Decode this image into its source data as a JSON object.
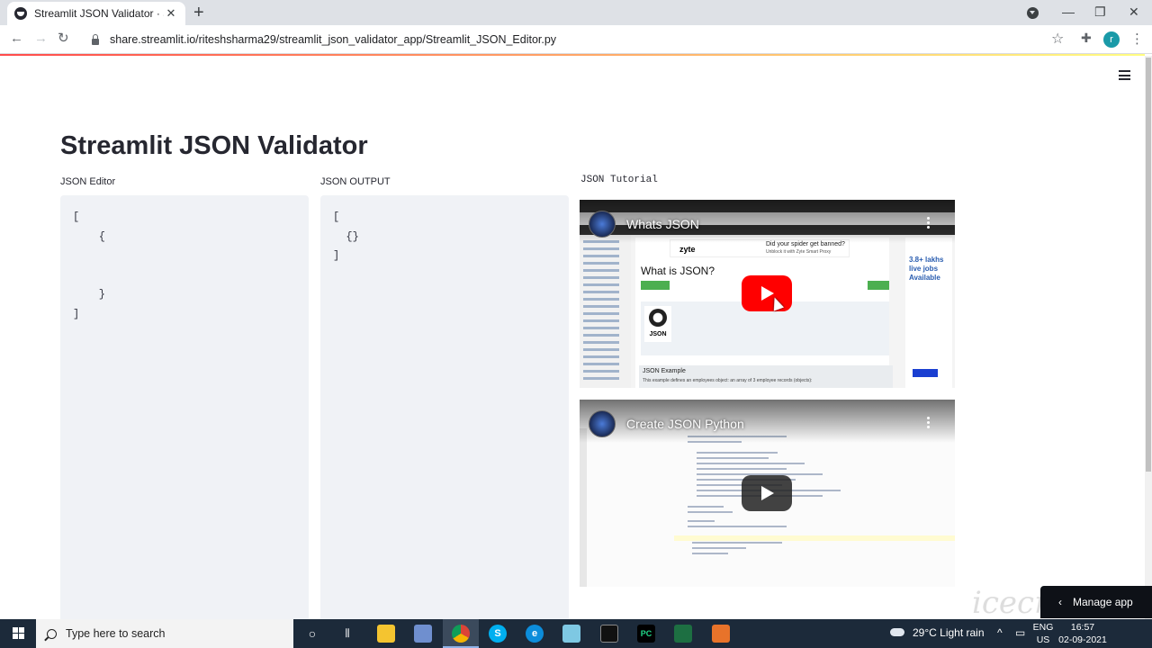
{
  "browser": {
    "tab_title": "Streamlit JSON Validator · Stream",
    "tab_close": "✕",
    "new_tab": "+",
    "url": "share.streamlit.io/riteshsharma29/streamlit_json_validator_app/Streamlit_JSON_Editor.py",
    "profile_initial": "r",
    "icons": [
      "back-icon",
      "forward-icon",
      "reload-icon",
      "lock-icon",
      "star-icon",
      "extensions-icon",
      "menu-icon"
    ]
  },
  "app": {
    "title": "Streamlit JSON Validator",
    "editor_label": "JSON Editor",
    "editor_value": "[\n    {\n\n\n    }\n]",
    "output_label": "JSON OUTPUT",
    "output_value": "[\n  {}\n]",
    "tutorial_label": "JSON Tutorial",
    "manage_app": "Manage app",
    "accent_color": "#ff4b4b"
  },
  "videos": [
    {
      "title": "Whats JSON",
      "inner": {
        "ad_text": "Did your spider get banned?",
        "ad_sub": "Unblock it with Zyte Smart Proxy",
        "brand": "zyte",
        "heading": "What is JSON?",
        "logo_text": "JSON",
        "side_promo": "3.8+ lakhs live jobs Available",
        "example_heading": "JSON Example",
        "example_text": "This example defines an employees object: an array of 3 employee records (objects):"
      }
    },
    {
      "title": "Create JSON Python"
    }
  ],
  "taskbar": {
    "search_placeholder": "Type here to search",
    "weather": "29°C  Light rain",
    "lang_top": "ENG",
    "lang_bottom": "US",
    "time": "16:57",
    "date": "02-09-2021",
    "apps": [
      {
        "name": "cortana-icon",
        "glyph": "O",
        "color": "transparent"
      },
      {
        "name": "task-view-icon",
        "glyph": "⫼",
        "color": "transparent"
      },
      {
        "name": "file-explorer-icon",
        "glyph": "",
        "color": "#f4c430"
      },
      {
        "name": "chrome-icon",
        "glyph": "",
        "color": "#db4437"
      },
      {
        "name": "skype-icon",
        "glyph": "S",
        "color": "#00aff0"
      },
      {
        "name": "edge-icon",
        "glyph": "e",
        "color": "#0c8ddb"
      },
      {
        "name": "pycharm-icon",
        "glyph": "PC",
        "color": "#21d789"
      }
    ]
  },
  "watermark": "icecream"
}
